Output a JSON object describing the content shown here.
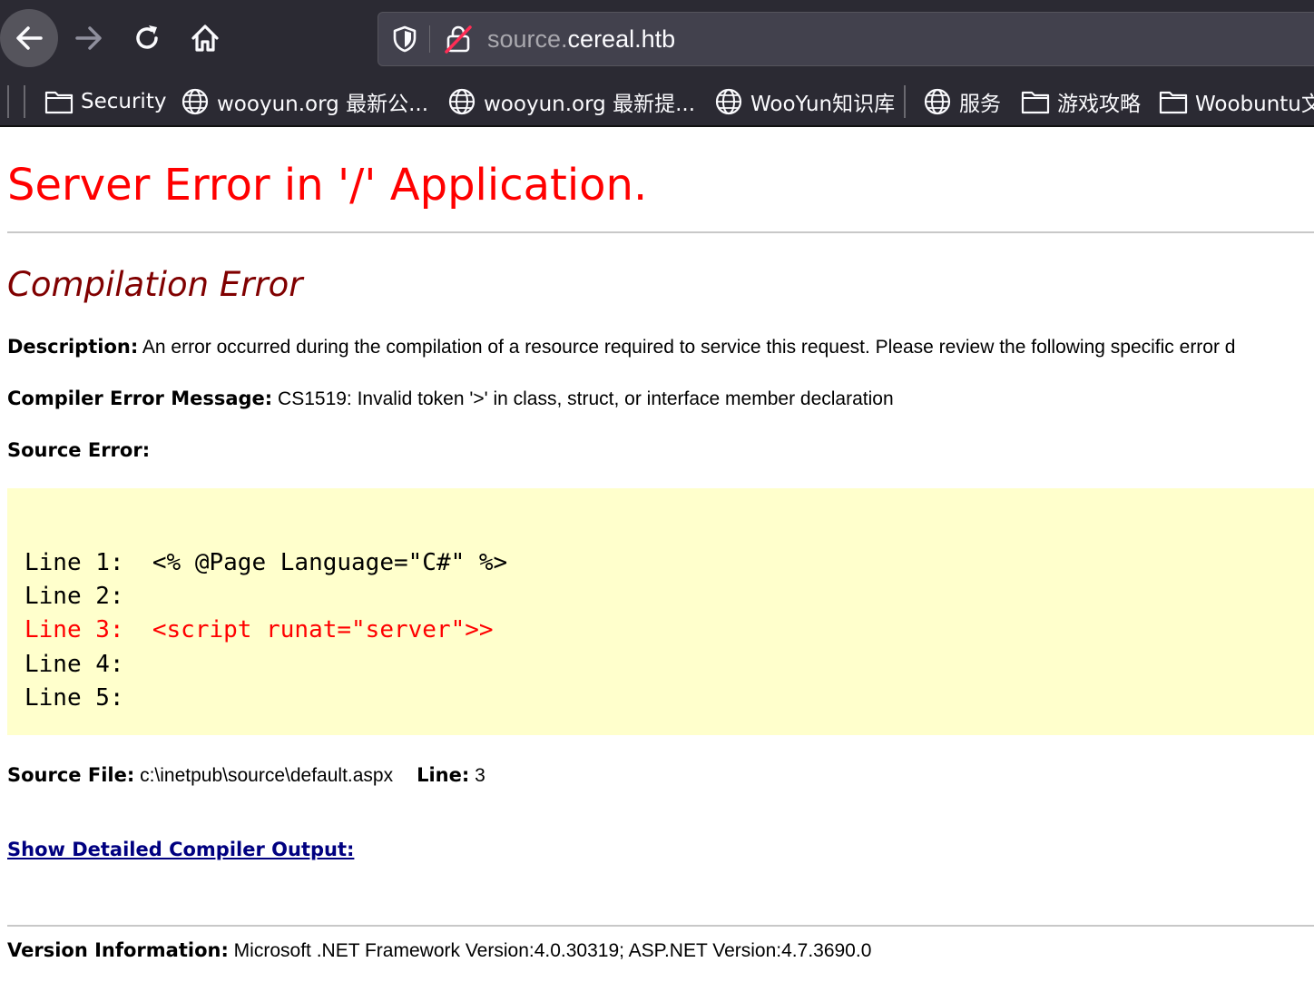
{
  "browser": {
    "url_subdomain": "source.",
    "url_domain": "cereal.htb",
    "bookmarks": [
      {
        "label": "Security",
        "icon": "folder-icon"
      },
      {
        "label": "wooyun.org 最新公...",
        "icon": "globe-icon"
      },
      {
        "label": "wooyun.org 最新提...",
        "icon": "globe-icon"
      },
      {
        "label": "WooYun知识库",
        "icon": "globe-icon"
      },
      {
        "label": "服务",
        "icon": "globe-icon"
      },
      {
        "label": "游戏攻略",
        "icon": "folder-icon"
      },
      {
        "label": "Woobuntu文",
        "icon": "folder-icon"
      }
    ]
  },
  "page": {
    "title": "Server Error in '/' Application.",
    "subtitle": "Compilation Error",
    "description_label": "Description:",
    "description_text": " An error occurred during the compilation of a resource required to service this request. Please review the following specific error d",
    "compiler_label": "Compiler Error Message:",
    "compiler_text": " CS1519: Invalid token '>' in class, struct, or interface member declaration",
    "source_error_label": "Source Error:",
    "code_lines": [
      "Line 1:  <% @Page Language=\"C#\" %>",
      "Line 2:",
      "Line 3:  <script runat=\"server\">>",
      "Line 4:",
      "Line 5:"
    ],
    "error_line_index": 2,
    "source_file_label": "Source File:",
    "source_file_value": " c:\\inetpub\\source\\default.aspx",
    "line_label": "Line:",
    "line_value": " 3",
    "detail_link": "Show Detailed Compiler Output:",
    "version_label": "Version Information:",
    "version_text": " Microsoft .NET Framework Version:4.0.30319; ASP.NET Version:4.7.3690.0"
  },
  "colors": {
    "title": "#ff0000",
    "subtitle": "#800000",
    "code_bg": "#ffffcc",
    "link": "#000080",
    "chrome_bg": "#2b2a33"
  }
}
